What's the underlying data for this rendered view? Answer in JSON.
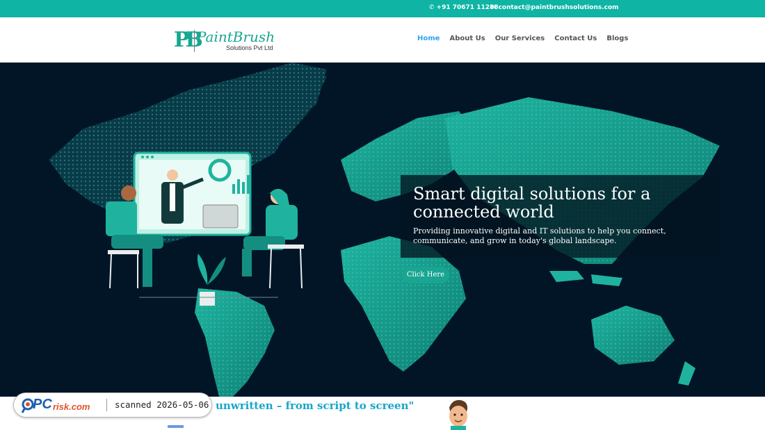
{
  "topbar": {
    "phone": "+91 70671 11288",
    "email": "contact@paintbrushsolutions.com",
    "phone_icon": "phone-icon",
    "email_icon": "envelope-icon"
  },
  "logo": {
    "mark": "PB",
    "name": "PaintBrush",
    "sub": "Solutions Pvt Ltd"
  },
  "nav": {
    "items": [
      "Home",
      "About Us",
      "Our Services",
      "Contact Us",
      "Blogs"
    ],
    "active": "Home"
  },
  "hero": {
    "title": "Smart digital solutions for a connected world",
    "subtitle": "Providing innovative digital and IT solutions to help you connect, communicate, and grow in today's global landscape.",
    "button": "Click Here",
    "slide_count": 5,
    "active_slide": 2
  },
  "bottom": {
    "tagline": "unwritten – from script to screen\""
  },
  "watermark": {
    "brand_pc": "PC",
    "brand_risk": "risk.com",
    "scanned": "scanned 2026-05-06"
  },
  "colors": {
    "accent": "#0fb4a4",
    "hero_bg": "#021526",
    "map": "#19a592",
    "nav_active": "#2ea3f2"
  }
}
